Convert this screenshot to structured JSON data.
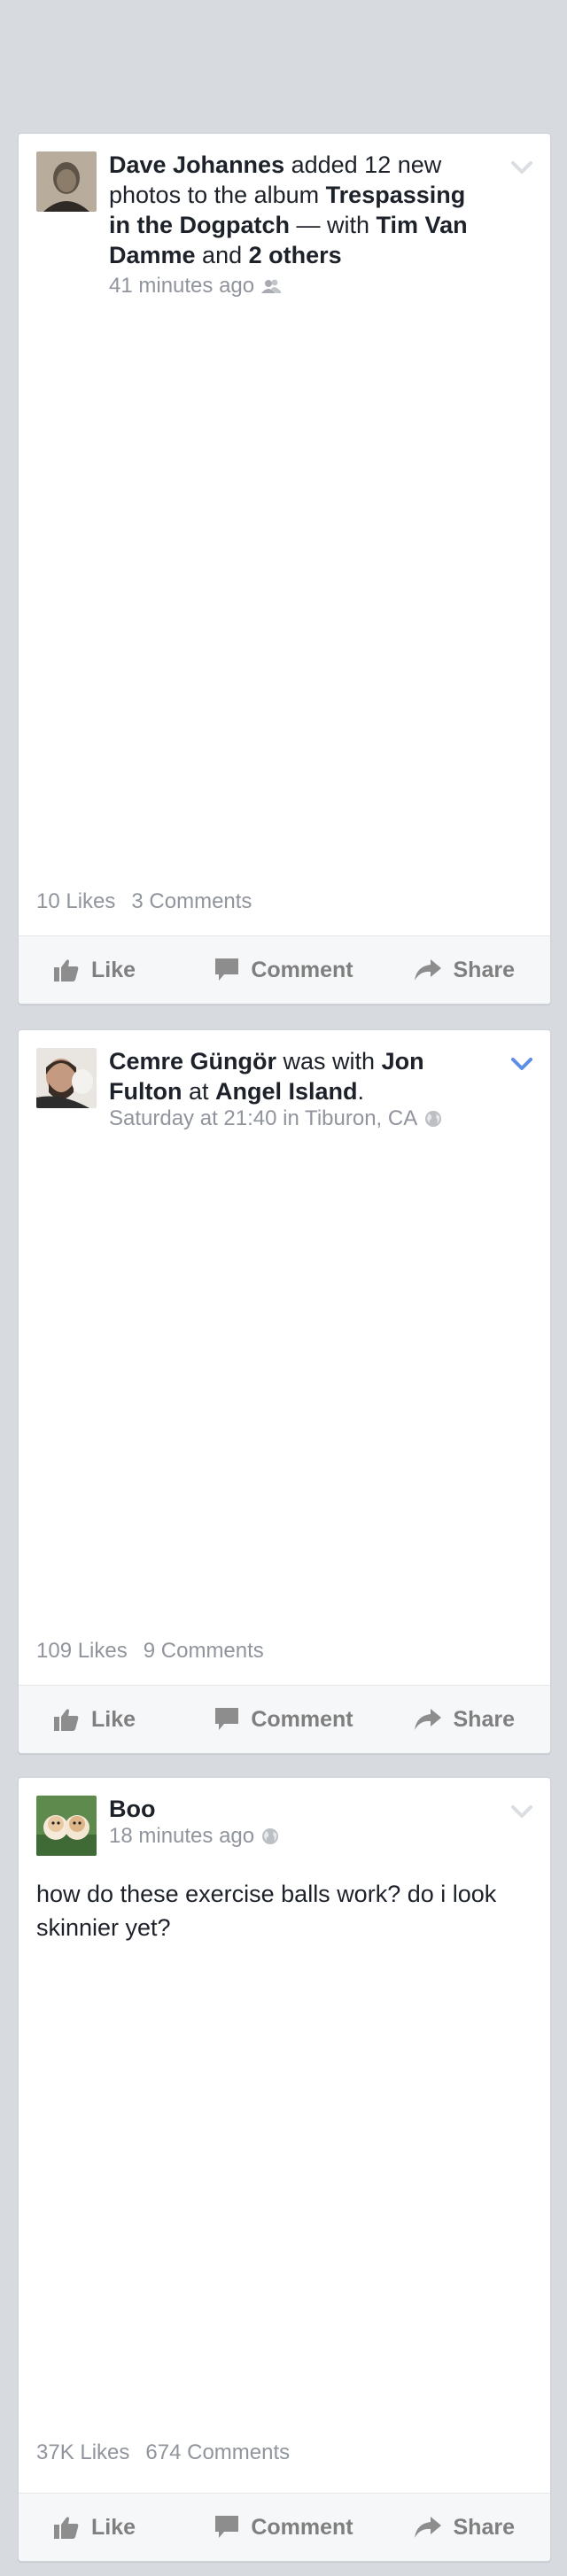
{
  "colors": {
    "background": "#d7dadf",
    "card": "#ffffff",
    "accent": "#5b8ee6",
    "muted": "#90949c",
    "text": "#1d2129"
  },
  "posts": [
    {
      "author": "Dave Johannes",
      "text_1": " added 12 new photos to the album ",
      "album": "Trespassing in the Dogpatch",
      "text_2": " — with ",
      "tag_1": "Tim Van Damme",
      "text_3": " and ",
      "tag_2": "2 others",
      "time": "41 minutes ago",
      "privacy_icon": "friends-icon",
      "likes": "10 Likes",
      "comments": "3 Comments",
      "menu_active": false
    },
    {
      "author": "Cemre Güngör",
      "text_1": " was with ",
      "tag_1": "Jon Fulton",
      "text_2": " at ",
      "place": "Angel Island",
      "text_3": ".",
      "time": "Saturday at 21:40 in Tiburon, CA",
      "privacy_icon": "globe-icon",
      "likes": "109 Likes",
      "comments": "9 Comments",
      "menu_active": true
    },
    {
      "author": "Boo",
      "time": "18 minutes ago",
      "privacy_icon": "globe-icon",
      "body": "how do these exercise balls work?  do i look skinnier yet?",
      "likes": "37K Likes",
      "comments": "674 Comments",
      "menu_active": false
    }
  ],
  "actions": {
    "like": "Like",
    "comment": "Comment",
    "share": "Share"
  }
}
